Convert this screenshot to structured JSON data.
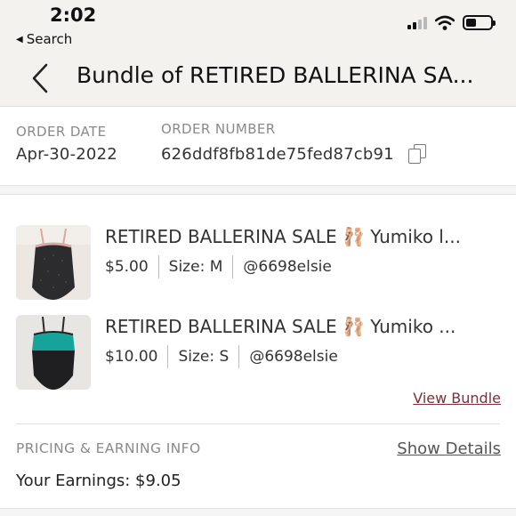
{
  "status_bar": {
    "time": "2:02",
    "back_label": "Search",
    "icons": [
      "signal-icon",
      "wifi-icon",
      "battery-icon"
    ]
  },
  "header": {
    "title": "Bundle of RETIRED BALLERINA SA..."
  },
  "order": {
    "date_label": "ORDER DATE",
    "date_value": "Apr-30-2022",
    "number_label": "ORDER NUMBER",
    "number_value": "626ddf8fb81de75fed87cb91"
  },
  "items": [
    {
      "title": "RETIRED BALLERINA SALE 🩰 Yumiko l...",
      "price": "$5.00",
      "size": "Size: M",
      "seller": "@6698elsie",
      "thumbnail": "black leotard with pink trim"
    },
    {
      "title": "RETIRED BALLERINA SALE 🩰 Yumiko ...",
      "price": "$10.00",
      "size": "Size: S",
      "seller": "@6698elsie",
      "thumbnail": "black and teal leotard"
    }
  ],
  "links": {
    "view_bundle": "View Bundle",
    "show_details": "Show Details"
  },
  "pricing": {
    "label": "PRICING & EARNING INFO",
    "earnings": "Your Earnings: $9.05"
  },
  "colors": {
    "header_bg": "#f3f2ef",
    "link_accent": "#7c2f3c",
    "muted_label": "#8a8a8a"
  }
}
